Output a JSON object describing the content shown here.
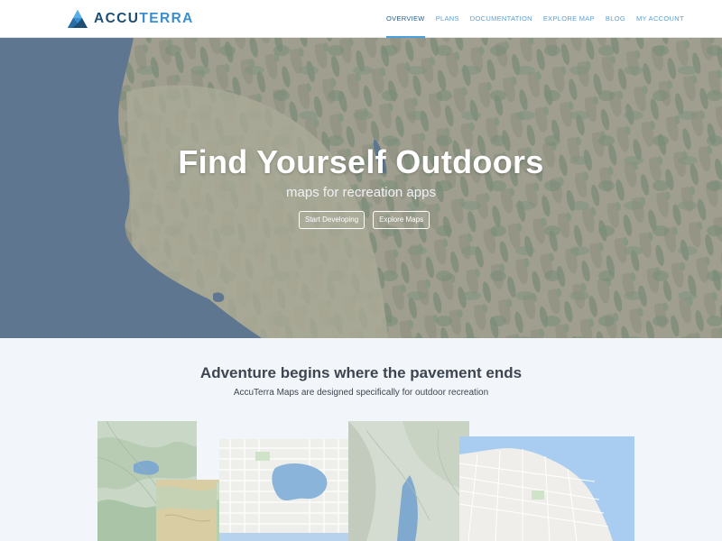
{
  "brand": {
    "name_part1": "ACCU",
    "name_part2": "TERRA"
  },
  "nav": {
    "items": [
      {
        "label": "OVERVIEW",
        "active": true
      },
      {
        "label": "PLANS",
        "active": false
      },
      {
        "label": "DOCUMENTATION",
        "active": false
      },
      {
        "label": "EXPLORE MAP",
        "active": false
      },
      {
        "label": "BLOG",
        "active": false
      },
      {
        "label": "MY ACCOUNT",
        "active": false
      }
    ]
  },
  "hero": {
    "title": "Find Yourself Outdoors",
    "subtitle": "maps for recreation apps",
    "buttons": {
      "primary": "Start Developing",
      "secondary": "Explore Maps"
    }
  },
  "section": {
    "title": "Adventure begins where the pavement ends",
    "subtitle": "AccuTerra Maps are designed specifically for outdoor recreation"
  },
  "colors": {
    "brand_dark": "#1d4e73",
    "brand_light": "#3a8ed0",
    "nav_link": "#5aa0d6",
    "nav_active_underline": "#4ba0dd",
    "section_bg": "#f2f5f9",
    "section_text": "#3d4650"
  }
}
